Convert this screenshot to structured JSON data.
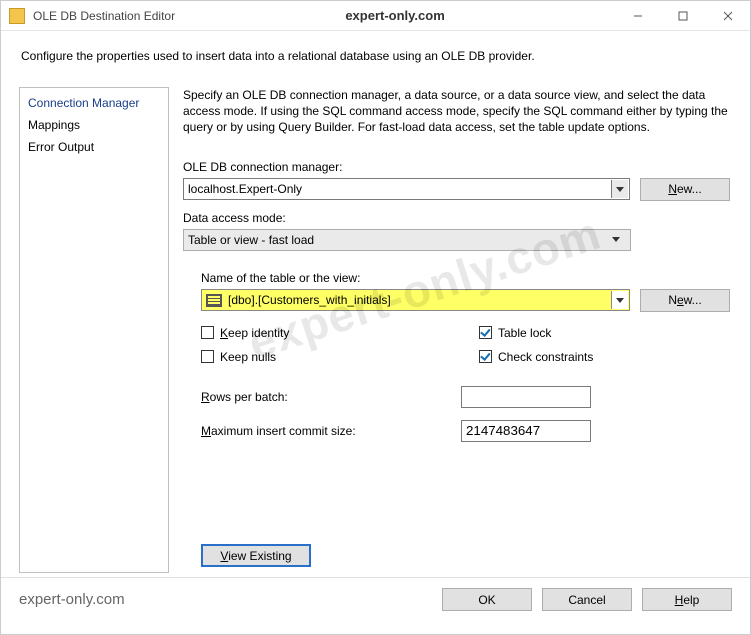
{
  "titlebar": {
    "title": "OLE DB Destination Editor",
    "center": "expert-only.com"
  },
  "description": "Configure the properties used to insert data into a relational database using an OLE DB provider.",
  "sidebar": {
    "items": [
      "Connection Manager",
      "Mappings",
      "Error Output"
    ]
  },
  "main": {
    "intro": "Specify an OLE DB connection manager, a data source, or a data source view, and select the data access mode. If using the SQL command access mode, specify the SQL command either by typing the query or by using Query Builder. For fast-load data access, set the table update options.",
    "conn_label": "OLE DB connection manager:",
    "conn_value": "localhost.Expert-Only",
    "new_label": "New...",
    "mode_label": "Data access mode:",
    "mode_value": "Table or view - fast load",
    "table_label": "Name of the table or the view:",
    "table_value": "[dbo].[Customers_with_initials]",
    "checks": {
      "keep_identity": "Keep identity",
      "keep_nulls": "Keep nulls",
      "table_lock": "Table lock",
      "check_constraints": "Check constraints"
    },
    "rows_per_batch_label": "Rows per batch:",
    "rows_per_batch_value": "",
    "max_commit_label": "Maximum insert commit size:",
    "max_commit_value": "2147483647",
    "view_existing": "View Existing"
  },
  "footer": {
    "brand": "expert-only.com",
    "ok": "OK",
    "cancel": "Cancel",
    "help": "Help"
  },
  "watermark": "expert-only.com"
}
